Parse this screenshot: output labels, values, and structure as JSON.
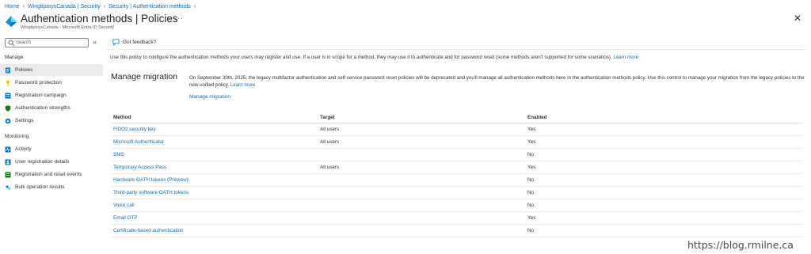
{
  "breadcrumb": [
    "Home",
    "WingtiptoysCanada | Security",
    "Security | Authentication methods"
  ],
  "header": {
    "title": "Authentication methods | Policies",
    "subtitle": "WingtiptoysCanada - Microsoft Entra ID Security",
    "more": "···",
    "close": "✕"
  },
  "sidebar": {
    "search_placeholder": "Search",
    "collapse": "«",
    "sections": [
      {
        "label": "Manage",
        "items": [
          {
            "label": "Policies",
            "icon": "policies-icon",
            "active": true
          },
          {
            "label": "Password protection",
            "icon": "key-icon"
          },
          {
            "label": "Registration campaign",
            "icon": "registration-icon"
          },
          {
            "label": "Authentication strengths",
            "icon": "shield-icon"
          },
          {
            "label": "Settings",
            "icon": "gear-icon"
          }
        ]
      },
      {
        "label": "Monitoring",
        "items": [
          {
            "label": "Activity",
            "icon": "activity-icon"
          },
          {
            "label": "User registration details",
            "icon": "user-icon"
          },
          {
            "label": "Registration and reset events",
            "icon": "events-icon"
          },
          {
            "label": "Bulk operation results",
            "icon": "bulk-icon"
          }
        ]
      }
    ]
  },
  "main": {
    "feedback": "Got feedback?",
    "intro": "Use this policy to configure the authentication methods your users may register and use. If a user is in scope for a method, they may use it to authenticate and for password reset (some methods aren't supported for some scenarios).",
    "intro_link": "Learn more",
    "migration": {
      "heading": "Manage migration",
      "body": "On September 30th, 2025, the legacy multifactor authentication and self-service password reset policies will be deprecated and you'll manage all authentication methods here in the authentication methods policy. Use this control to manage your migration from the legacy policies to the new unified policy.",
      "body_link": "Learn more",
      "link": "Manage migration"
    },
    "table": {
      "headers": [
        "Method",
        "Target",
        "Enabled"
      ],
      "rows": [
        {
          "method": "FIDO2 security key",
          "target": "All users",
          "enabled": "Yes"
        },
        {
          "method": "Microsoft Authenticator",
          "target": "All users",
          "enabled": "Yes"
        },
        {
          "method": "SMS",
          "target": "",
          "enabled": "No"
        },
        {
          "method": "Temporary Access Pass",
          "target": "All users",
          "enabled": "Yes"
        },
        {
          "method": "Hardware OATH tokens (Preview)",
          "target": "",
          "enabled": "No"
        },
        {
          "method": "Third-party software OATH tokens",
          "target": "",
          "enabled": "No"
        },
        {
          "method": "Voice call",
          "target": "",
          "enabled": "No"
        },
        {
          "method": "Email OTP",
          "target": "",
          "enabled": "Yes"
        },
        {
          "method": "Certificate-based authentication",
          "target": "",
          "enabled": "No"
        }
      ]
    }
  },
  "watermark": "https://blog.rmilne.ca",
  "colors": {
    "link": "#0f6cbd",
    "active_nav": "#edebe9",
    "text": "#323130"
  }
}
